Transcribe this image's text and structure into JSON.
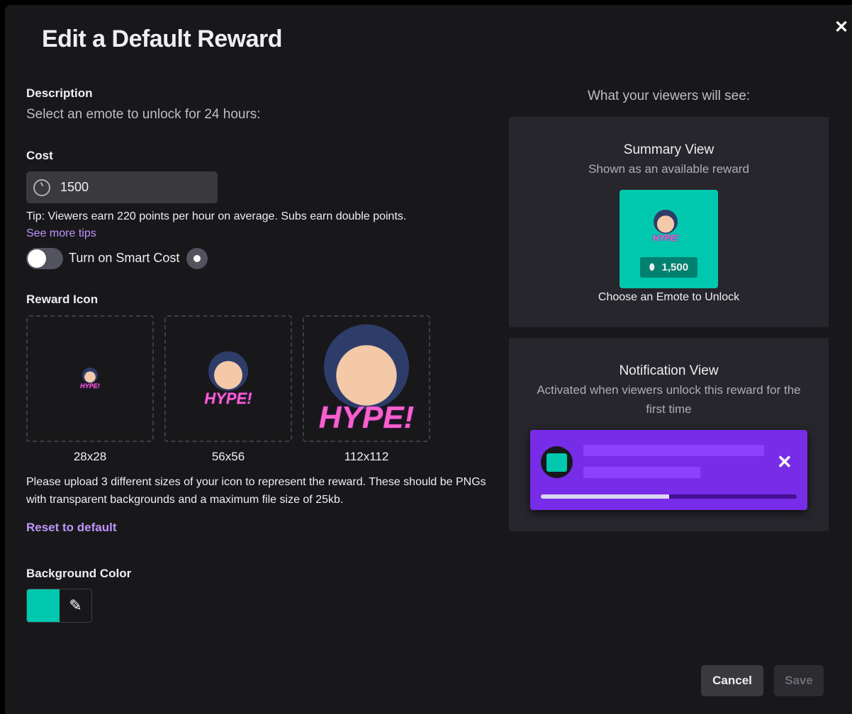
{
  "modal": {
    "title": "Edit a Default Reward",
    "close_icon": "close-icon"
  },
  "description": {
    "label": "Description",
    "text": "Select an emote to unlock for 24 hours:"
  },
  "cost": {
    "label": "Cost",
    "value": "1500",
    "icon": "channel-points-icon",
    "tip": "Tip: Viewers earn 220 points per hour on average. Subs earn double points.",
    "more_tips": "See more tips"
  },
  "smart_cost": {
    "label": "Turn on Smart Cost",
    "enabled": false,
    "icon": "lightbulb-icon"
  },
  "reward_icon": {
    "label": "Reward Icon",
    "emote_text": "HYPE!",
    "sizes": [
      "28x28",
      "56x56",
      "112x112"
    ],
    "help": "Please upload 3 different sizes of your icon to represent the reward. These should be PNGs with transparent backgrounds and a maximum file size of 25kb.",
    "reset": "Reset to default"
  },
  "background_color": {
    "label": "Background Color",
    "value": "#00c8af",
    "picker_icon": "eyedropper-icon"
  },
  "preview": {
    "heading": "What your viewers will see:",
    "summary": {
      "title": "Summary View",
      "subtitle": "Shown as an available reward",
      "price": "1,500",
      "reward_title": "Choose an Emote to Unlock"
    },
    "notification": {
      "title": "Notification View",
      "subtitle": "Activated when viewers unlock this reward for the first time",
      "progress": 0.5,
      "color": "#772ce8"
    }
  },
  "footer": {
    "cancel": "Cancel",
    "save": "Save",
    "save_disabled": true
  }
}
